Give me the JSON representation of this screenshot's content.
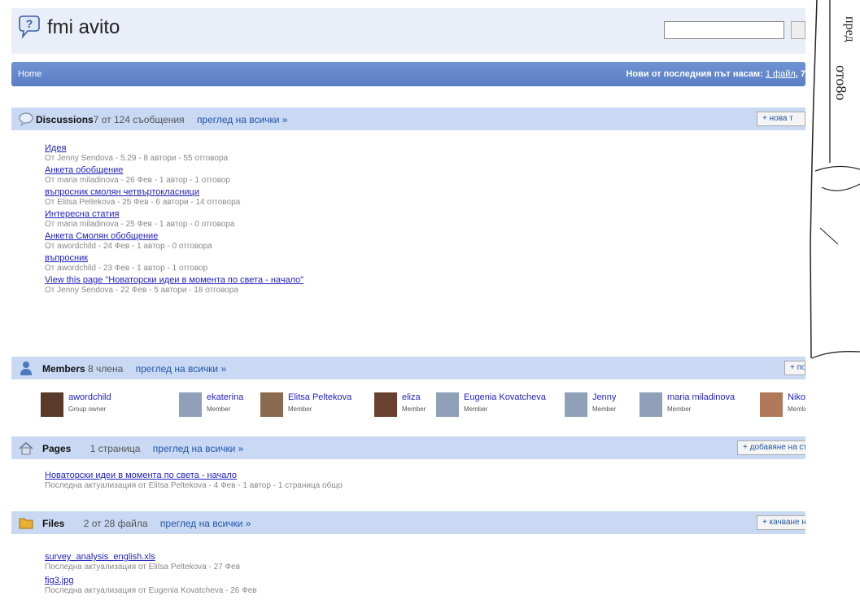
{
  "header": {
    "site_title": "fmi avito"
  },
  "nav": {
    "home": "Home",
    "new_since_text": "Нови от последния път насам:",
    "new_files_link": "1 файл",
    "new_more": ", 7"
  },
  "discussions": {
    "title": "Discussions",
    "count": "7 от 124 съобщения",
    "view_all": "преглед на всички »",
    "new_button": "+ нова т",
    "items": [
      {
        "title": "Идея",
        "meta": "От Jenny Sendova - 5.29 - 8 автори - 55 отговора"
      },
      {
        "title": "Анкета обобщение",
        "meta": "От maria miladinova - 26 Фев - 1 автор - 1 отговор"
      },
      {
        "title": "въпросник смолян четвъртокласници",
        "meta": "От Elitsa Peltekova - 25 Фев - 6 автори - 14 отговора"
      },
      {
        "title": "Интересна статия",
        "meta": "От maria miladinova - 25 Фев - 1 автор - 0 отговора"
      },
      {
        "title": "Анкета Смолян обобщение",
        "meta": "От awordchild - 24 Фев - 1 автор - 0 отговора"
      },
      {
        "title": "въпросник",
        "meta": "От awordchild - 23 Фев - 1 автор - 1 отговор"
      },
      {
        "title": "View this page \"Новаторски идеи в момента по света - начало\"",
        "meta": "От Jenny Sendova - 22 Фев - 5 автори - 18 отговора"
      }
    ]
  },
  "members": {
    "title": "Members",
    "count": "8 члена",
    "view_all": "преглед на всички »",
    "invite_button": "+ поканване",
    "list": [
      {
        "name": "awordchild",
        "role": "Group owner"
      },
      {
        "name": "ekaterina",
        "role": "Member"
      },
      {
        "name": "Elitsa Peltekova",
        "role": "Member"
      },
      {
        "name": "eliza",
        "role": "Member"
      },
      {
        "name": "Eugenia Kovatcheva",
        "role": "Member"
      },
      {
        "name": "Jenny",
        "role": "Member"
      },
      {
        "name": "maria miladinova",
        "role": "Member"
      },
      {
        "name": "Nikolina Nikolova",
        "role": "Member"
      }
    ]
  },
  "pages": {
    "title": "Pages",
    "count": "1 страница",
    "view_all": "преглед на всички »",
    "add_button": "+ добавяне на страница",
    "items": [
      {
        "title": "Новаторски идеи в момента по света - начало",
        "meta": "Последна актуализация от Elitsa Peltekova - 4 Фев - 1 автор - 1 страница общо"
      }
    ]
  },
  "files": {
    "title": "Files",
    "count": "2 от 28 файла",
    "view_all": "преглед на всички »",
    "upload_button": "+ качване на файл",
    "items": [
      {
        "title": "survey_analysis_english.xls",
        "meta": "Последна актуализация от Elitsa Peltekova - 27 Фев"
      },
      {
        "title": "fig3.jpg",
        "meta": "Последна актуализация от Eugenia Kovatcheva - 26 Фев"
      }
    ]
  },
  "colors": {
    "nav_bar": "#5a7fc4",
    "section_header": "#c9d9f3",
    "link": "#1f1fbf"
  }
}
